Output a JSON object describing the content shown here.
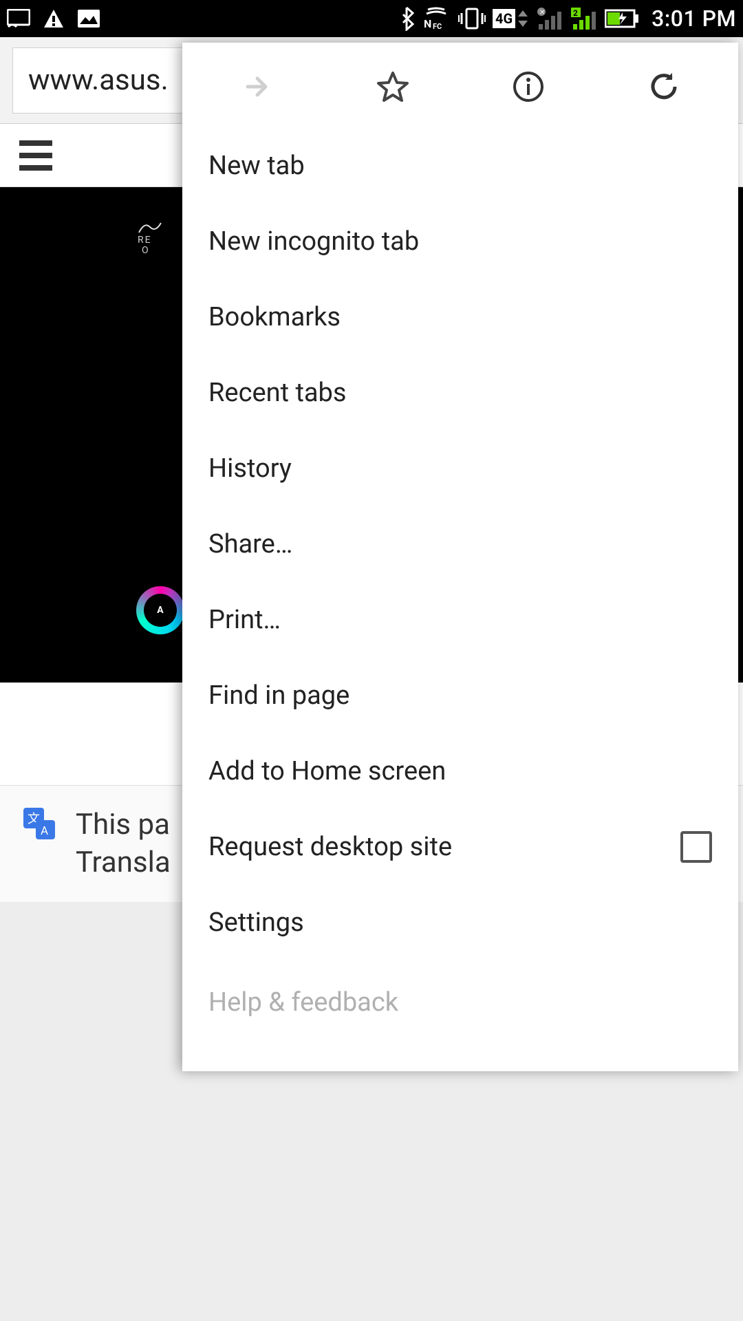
{
  "status": {
    "time": "3:01 PM",
    "network_label": "4G",
    "sim2_badge": "2"
  },
  "browser": {
    "url": "www.asus."
  },
  "page": {
    "logo_line1": "RE",
    "logo_line2": "O",
    "aura_letter": "A"
  },
  "translate_bar": {
    "line1": "This pa",
    "line2": "Transla"
  },
  "menu": {
    "items": [
      "New tab",
      "New incognito tab",
      "Bookmarks",
      "Recent tabs",
      "History",
      "Share…",
      "Print…",
      "Find in page",
      "Add to Home screen",
      "Request desktop site",
      "Settings",
      "Help & feedback"
    ],
    "desktop_checked": false
  }
}
